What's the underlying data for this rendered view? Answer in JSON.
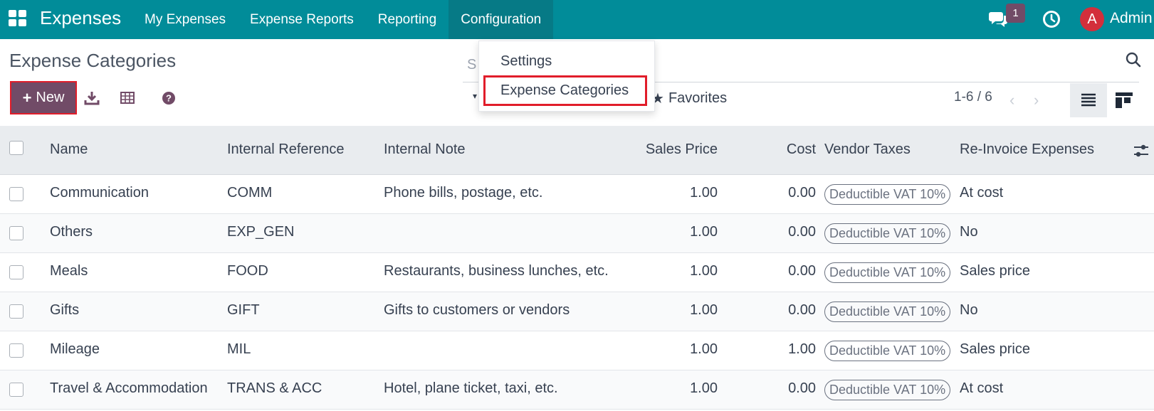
{
  "navbar": {
    "app_name": "Expenses",
    "menu": [
      {
        "label": "My Expenses"
      },
      {
        "label": "Expense Reports"
      },
      {
        "label": "Reporting"
      },
      {
        "label": "Configuration"
      }
    ],
    "chat_badge": "1",
    "avatar_initial": "A",
    "user_name": "Admin",
    "accent_color": "#018c99"
  },
  "control_panel": {
    "title": "Expense Categories",
    "new_label": "New",
    "search_prefix": "S",
    "favorites_label": "Favorites",
    "pager": "1-6 / 6"
  },
  "dropdown": {
    "items": [
      {
        "label": "Settings"
      },
      {
        "label": "Expense Categories"
      }
    ]
  },
  "table": {
    "columns": [
      "Name",
      "Internal Reference",
      "Internal Note",
      "Sales Price",
      "Cost",
      "Vendor Taxes",
      "Re-Invoice Expenses"
    ],
    "rows": [
      {
        "name": "Communication",
        "ref": "COMM",
        "note": "Phone bills, postage, etc.",
        "sales": "1.00",
        "cost": "0.00",
        "tax": "Deductible VAT 10%",
        "reinvoice": "At cost"
      },
      {
        "name": "Others",
        "ref": "EXP_GEN",
        "note": "",
        "sales": "1.00",
        "cost": "0.00",
        "tax": "Deductible VAT 10%",
        "reinvoice": "No"
      },
      {
        "name": "Meals",
        "ref": "FOOD",
        "note": "Restaurants, business lunches, etc.",
        "sales": "1.00",
        "cost": "0.00",
        "tax": "Deductible VAT 10%",
        "reinvoice": "Sales price"
      },
      {
        "name": "Gifts",
        "ref": "GIFT",
        "note": "Gifts to customers or vendors",
        "sales": "1.00",
        "cost": "0.00",
        "tax": "Deductible VAT 10%",
        "reinvoice": "No"
      },
      {
        "name": "Mileage",
        "ref": "MIL",
        "note": "",
        "sales": "1.00",
        "cost": "1.00",
        "tax": "Deductible VAT 10%",
        "reinvoice": "Sales price"
      },
      {
        "name": "Travel & Accommodation",
        "ref": "TRANS & ACC",
        "note": "Hotel, plane ticket, taxi, etc.",
        "sales": "1.00",
        "cost": "0.00",
        "tax": "Deductible VAT 10%",
        "reinvoice": "At cost"
      }
    ]
  }
}
